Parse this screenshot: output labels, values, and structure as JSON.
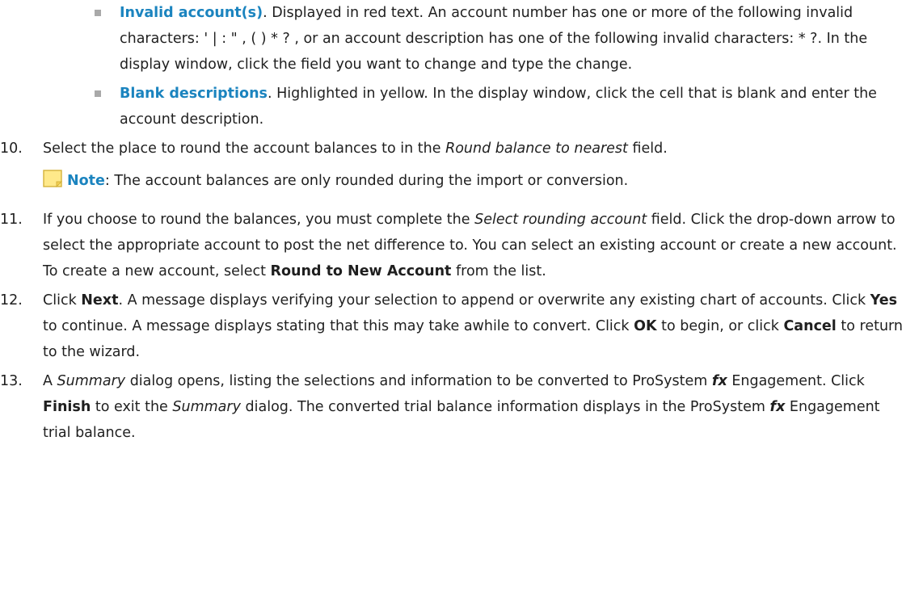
{
  "colors": {
    "accent_blue": "#1b84bf",
    "bullet_gray": "#a9a9a9",
    "note_icon_yellow": "#ffe98a",
    "note_icon_border": "#d4b23a",
    "text": "#1f1f1f"
  },
  "sub_items": [
    {
      "term": "Invalid account(s)",
      "text": ". Displayed in red text. An account number has one or more of the following invalid characters: ' | : \" , ( ) * ? , or an account description has one of the following invalid characters: * ?. In the display window, click the field you want to change and type the change."
    },
    {
      "term": "Blank descriptions",
      "text": ". Highlighted in yellow. In the display window, click the cell that is blank and enter the account description."
    }
  ],
  "step10": {
    "num": "10.",
    "text_before": "Select the place to round the account balances to in the ",
    "field": "Round balance to nearest",
    "text_after": "  field.",
    "note_icon": "note-icon",
    "note_label": "Note",
    "note_text": ": The account balances are only rounded during the import or conversion."
  },
  "step11": {
    "num": "11.",
    "text_before": "If you choose to round the balances, you must complete the ",
    "field": "Select rounding account",
    "text_middle": "  field. Click the drop-down arrow to select the appropriate account to post the net difference to. You can select an existing account or create a new account. To create a new account, select ",
    "bold": "Round to New Account",
    "text_after": " from the list."
  },
  "step12": {
    "num": "12.",
    "t1": "Click ",
    "b1": "Next",
    "t2": ". A message displays verifying your selection to append or overwrite any existing chart of accounts. Click ",
    "b2": "Yes",
    "t3": " to continue. A message displays stating that this may take awhile to convert. Click ",
    "b3": "OK",
    "t4": " to begin, or click ",
    "b4": "Cancel",
    "t5": " to return to the wizard."
  },
  "step13": {
    "num": "13.",
    "t1": "A ",
    "i1": "Summary",
    "t2": " dialog opens, listing the selections and information to be converted to ProSystem ",
    "i2": "fx",
    "t3": "  Engagement. Click ",
    "b1": "Finish",
    "t4": " to exit the ",
    "i3": "Summary",
    "t5": " dialog.  The converted trial balance information displays in the ProSystem ",
    "i4": "fx",
    "t6": "  Engagement trial balance."
  }
}
